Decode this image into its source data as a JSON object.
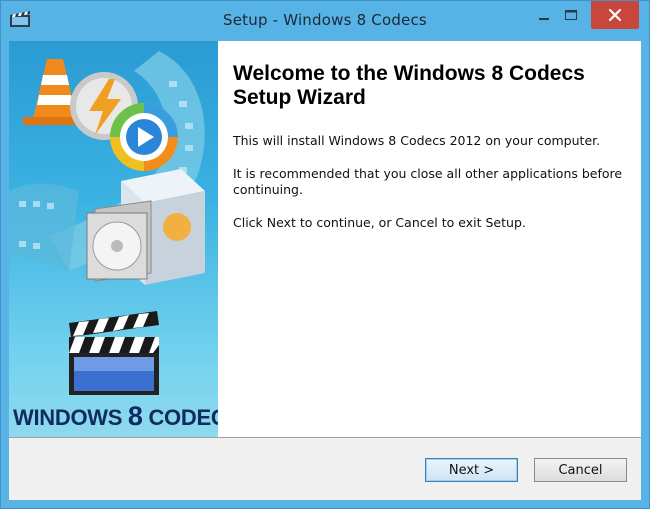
{
  "window": {
    "title": "Setup - Windows 8 Codecs"
  },
  "sidebar": {
    "brand_prefix": "WINDOWS",
    "brand_number": "8",
    "brand_suffix": "CODECS"
  },
  "main": {
    "heading": "Welcome to the Windows 8 Codecs Setup Wizard",
    "paragraphs": [
      "This will install Windows 8 Codecs 2012 on your computer.",
      "It is recommended that you close all other applications before continuing.",
      "Click Next to continue, or Cancel to exit Setup."
    ]
  },
  "buttons": {
    "next": "Next >",
    "cancel": "Cancel"
  },
  "colors": {
    "titlebar": "#57b2e5",
    "close": "#c9463d",
    "brand": "#0f2c5c"
  },
  "icons": [
    "app-icon",
    "minimize-icon",
    "maximize-icon",
    "close-icon",
    "vlc-cone-icon",
    "media-player-icon",
    "cd-box-icon",
    "clapperboard-icon"
  ]
}
